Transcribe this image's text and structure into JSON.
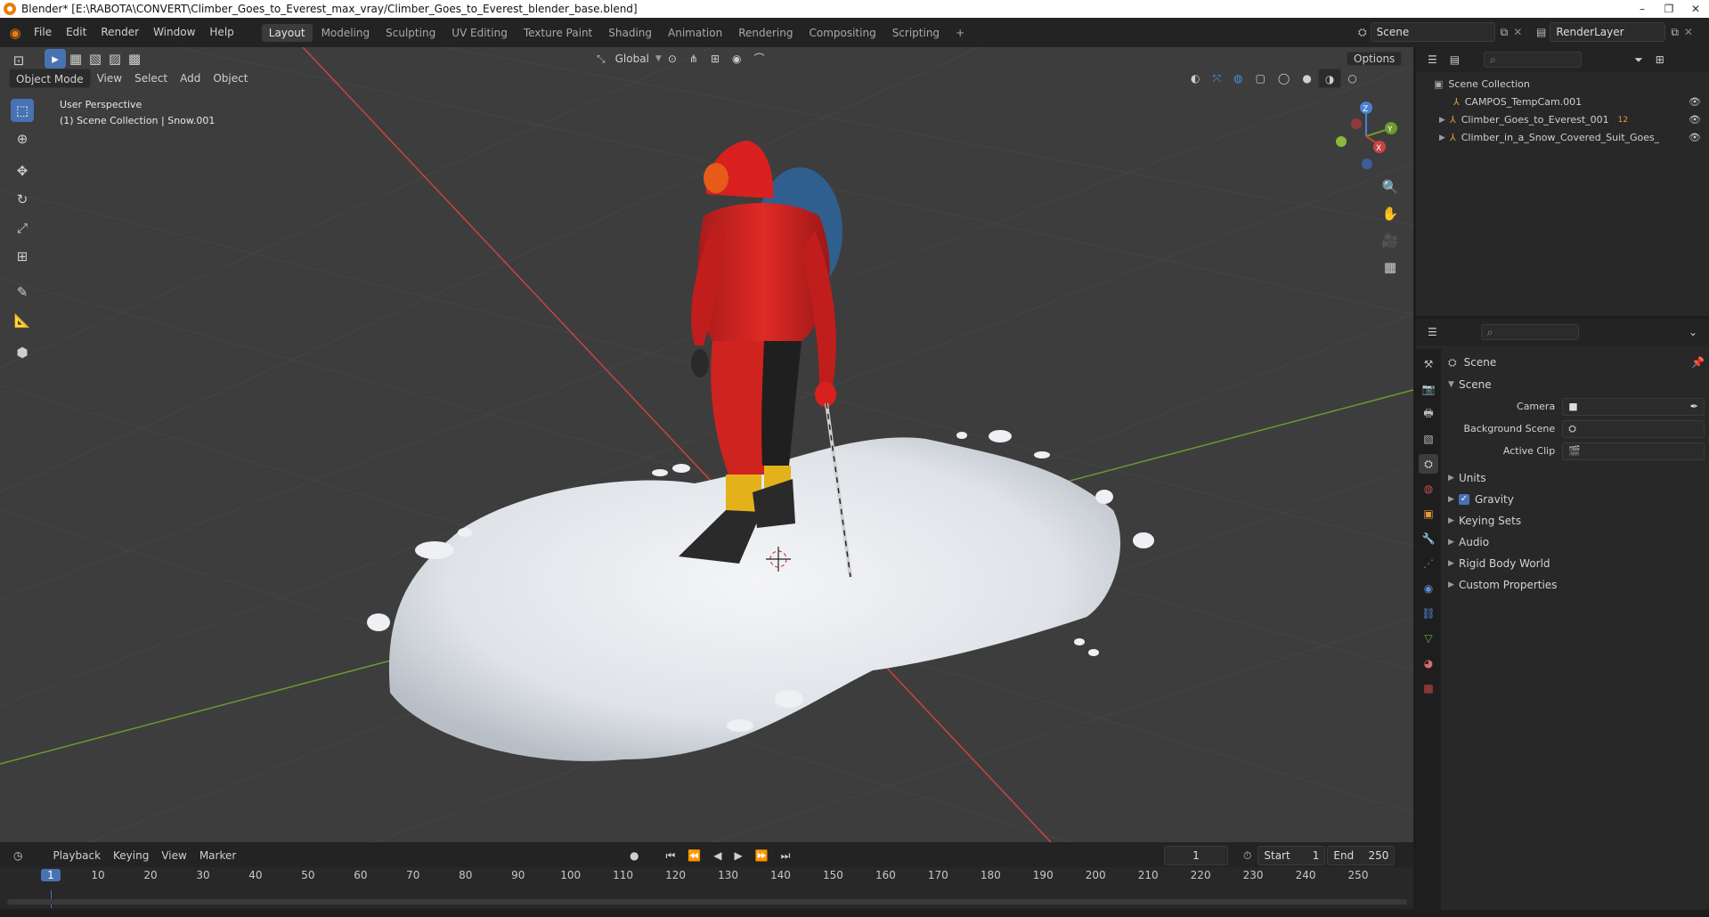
{
  "window": {
    "title": "Blender* [E:\\RABOTA\\CONVERT\\Climber_Goes_to_Everest_max_vray/Climber_Goes_to_Everest_blender_base.blend]",
    "controls": [
      "–",
      "❐",
      "✕"
    ]
  },
  "menubar": {
    "menus": [
      "File",
      "Edit",
      "Render",
      "Window",
      "Help"
    ],
    "workspaces": [
      "Layout",
      "Modeling",
      "Sculpting",
      "UV Editing",
      "Texture Paint",
      "Shading",
      "Animation",
      "Rendering",
      "Compositing",
      "Scripting"
    ],
    "active_workspace": "Layout",
    "add_tab": "+",
    "scene_name": "Scene",
    "render_layer": "RenderLayer"
  },
  "viewport": {
    "mode": "Object Mode",
    "header_menus": [
      "View",
      "Select",
      "Add",
      "Object"
    ],
    "transform_orientation": "Global",
    "options_label": "Options",
    "overlay_title": "User Perspective",
    "overlay_subtitle": "(1) Scene Collection | Snow.001",
    "gizmo_axes": {
      "x": "X",
      "y": "Y",
      "z": "Z"
    },
    "colors": {
      "background": "#3d3d3d",
      "x_axis": "#c84444",
      "y_axis": "#6c9b2c",
      "active_tool": "#4772b3"
    }
  },
  "outliner": {
    "root": "Scene Collection",
    "items": [
      {
        "label": "CAMPOS_TempCam.001",
        "expandable": false
      },
      {
        "label": "Climber_Goes_to_Everest_001",
        "expandable": true,
        "badge": "12"
      },
      {
        "label": "Climber_in_a_Snow_Covered_Suit_Goes_to_E",
        "expandable": true
      }
    ]
  },
  "properties": {
    "context": "Scene",
    "section": "Scene",
    "fields": [
      {
        "label": "Camera",
        "value": ""
      },
      {
        "label": "Background Scene",
        "value": ""
      },
      {
        "label": "Active Clip",
        "value": ""
      }
    ],
    "subsections": [
      "Units",
      "Gravity",
      "Keying Sets",
      "Audio",
      "Rigid Body World",
      "Custom Properties"
    ],
    "gravity_checked": true
  },
  "timeline": {
    "menus": [
      "Playback",
      "Keying",
      "View",
      "Marker"
    ],
    "current_frame": "1",
    "start_label": "Start",
    "start": "1",
    "end_label": "End",
    "end": "250",
    "ticks": [
      "1",
      "10",
      "20",
      "30",
      "40",
      "50",
      "60",
      "70",
      "80",
      "90",
      "100",
      "110",
      "120",
      "130",
      "140",
      "150",
      "160",
      "170",
      "180",
      "190",
      "200",
      "210",
      "220",
      "230",
      "240",
      "250"
    ]
  }
}
